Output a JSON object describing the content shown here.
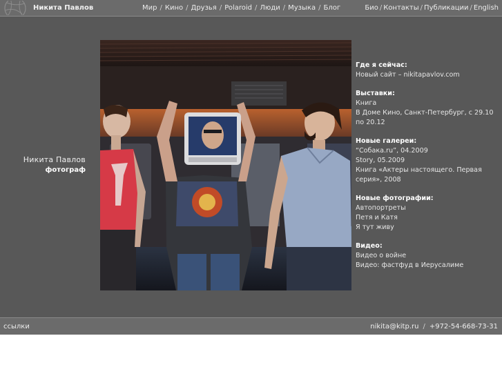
{
  "header": {
    "site_name": "Никита Павлов",
    "main_nav": [
      "Мир",
      "Кино",
      "Друзья",
      "Polaroid",
      "Люди",
      "Музыка",
      "Блог"
    ],
    "right_nav": [
      "Био",
      "Контакты",
      "Публикации",
      "English"
    ],
    "separator": "/"
  },
  "author": {
    "name": "Никита Павлов",
    "role": "фотограф"
  },
  "info": {
    "where_now": {
      "heading": "Где я сейчас:",
      "items": [
        "Новый сайт – nikitapavlov.com"
      ]
    },
    "exhibitions": {
      "heading": "Выставки:",
      "items": [
        "Книга",
        "В Доме Кино, Санкт-Петербург, с 29.10 по 20.12"
      ]
    },
    "galleries": {
      "heading": "Новые галереи:",
      "items": [
        "“Собака.ru”, 04.2009",
        "Story, 05.2009",
        "Книга «Актеры настоящего. Первая серия», 2008"
      ]
    },
    "photos": {
      "heading": "Новые фотографии:",
      "items": [
        "Автопортреты",
        "Петя и Катя",
        "Я тут живу"
      ]
    },
    "video": {
      "heading": "Видео:",
      "items": [
        "Видео о войне",
        "Видео: фастфуд в Иерусалиме"
      ]
    }
  },
  "footer": {
    "links_label": "ссылки",
    "email": "nikita@kitp.ru",
    "separator": "/",
    "phone": "+972-54-668-73-31"
  }
}
